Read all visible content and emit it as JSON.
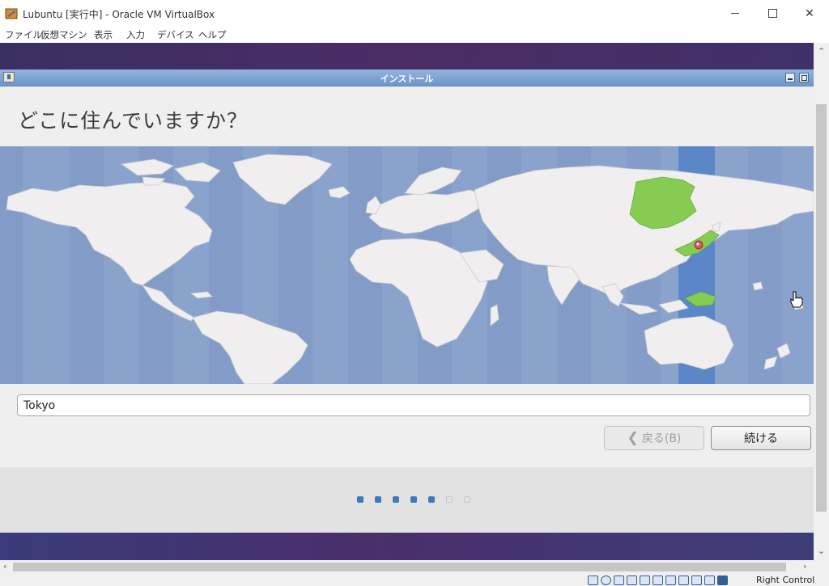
{
  "window": {
    "title": "Lubuntu [実行中] - Oracle VM VirtualBox",
    "controls": {
      "minimize": "—",
      "maximize": "☐",
      "close": "✕"
    }
  },
  "menubar": {
    "items": [
      "ファイル",
      "仮想マシン",
      "表示",
      "入力",
      "デバイス",
      "ヘルプ"
    ]
  },
  "installer": {
    "window_title": "インストール",
    "heading": "どこに住んでいますか？",
    "timezone_value": "Tokyo",
    "back_label": "戻る(B)",
    "back_chevron": "❮",
    "continue_label": "続ける",
    "progress": {
      "total_steps": 7,
      "completed_steps": 5
    },
    "map": {
      "selected_zone": "UTC+9",
      "selected_city": "Tokyo",
      "colors": {
        "ocean": "#8aa3cc",
        "land": "#f0eeee",
        "zone_band": "#5b86c7",
        "selected_country": "#86cc52",
        "pin": "#e8505b"
      }
    }
  },
  "scrollbars": {
    "up": "▲",
    "down": "▼",
    "left": "◀",
    "right": "▶"
  },
  "statusbar": {
    "host_key": "Right Control",
    "icons": [
      "hard-disk-icon",
      "optical-drive-icon",
      "audio-icon",
      "network-icon",
      "usb-icon",
      "shared-folders-icon",
      "display-icon",
      "video-capture-icon",
      "mouse-integration-icon",
      "cpu-icon",
      "host-key-icon"
    ]
  },
  "colors": {
    "accent": "#3d79c0",
    "desktop_purple": "#4b2c66"
  }
}
